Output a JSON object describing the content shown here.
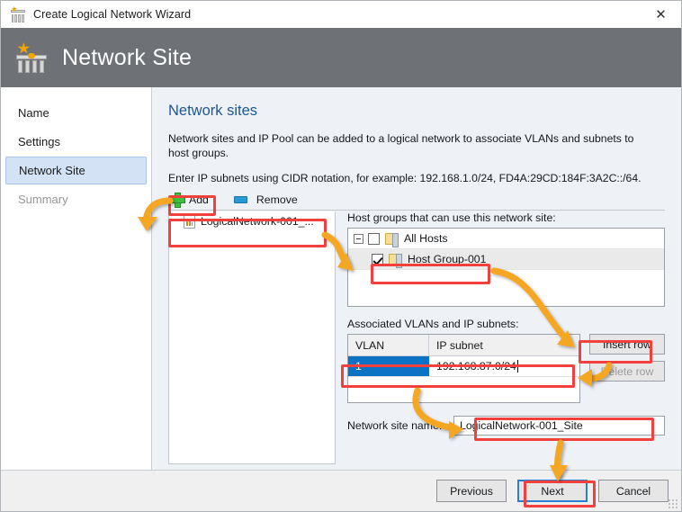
{
  "window": {
    "title": "Create Logical Network Wizard",
    "title_icon": "network-site-icon",
    "close_label": "✕",
    "header_title": "Network Site",
    "header_icon": "network-site-wizard-icon",
    "header_bg": "#6e7277"
  },
  "sidebar": {
    "items": [
      {
        "label": "Name",
        "state": "normal"
      },
      {
        "label": "Settings",
        "state": "normal"
      },
      {
        "label": "Network Site",
        "state": "active"
      },
      {
        "label": "Summary",
        "state": "disabled"
      }
    ]
  },
  "content": {
    "heading": "Network sites",
    "paragraph1": "Network sites and IP Pool can be added to a logical network to associate VLANs and subnets to host groups.",
    "paragraph2": "Enter IP subnets using CIDR notation, for example: 192.168.1.0/24, FD4A:29CD:184F:3A2C::/64.",
    "toolbar": {
      "add_label": "Add",
      "add_icon": "green-plus-icon",
      "remove_label": "Remove",
      "remove_icon": "blue-minus-icon"
    },
    "site_list": {
      "items": [
        {
          "label": "LogicalNetwork-001_...",
          "icon": "network-site-doc-icon"
        }
      ]
    },
    "host_groups": {
      "label": "Host groups that can use this network site:",
      "rows": [
        {
          "label": "All Hosts",
          "checked": false,
          "expander": "−",
          "icon": "folder-icon",
          "indent": 0,
          "selected": false
        },
        {
          "label": "Host Group-001",
          "checked": true,
          "icon": "folder-icon",
          "indent": 1,
          "selected": true
        }
      ]
    },
    "vlan_table": {
      "label": "Associated VLANs and IP subnets:",
      "columns": [
        "VLAN",
        "IP subnet"
      ],
      "rows": [
        {
          "vlan": "1",
          "subnet": "192.168.87.0/24"
        }
      ],
      "insert_row_label": "Insert row",
      "delete_row_label": "Delete row",
      "delete_row_enabled": false
    },
    "site_name": {
      "label": "Network site name:",
      "value": "LogicalNetwork-001_Site"
    }
  },
  "footer": {
    "previous_label": "Previous",
    "next_label": "Next",
    "cancel_label": "Cancel",
    "default_button": "Next"
  },
  "annotations": {
    "highlight_color": "#f2413c",
    "arrow_color": "#f5a623",
    "highlighted_targets": [
      "Add",
      "LogicalNetwork-001_...",
      "Host Group-001",
      "Insert row",
      "192.168.87.0/24",
      "LogicalNetwork-001_Site",
      "Next"
    ]
  }
}
